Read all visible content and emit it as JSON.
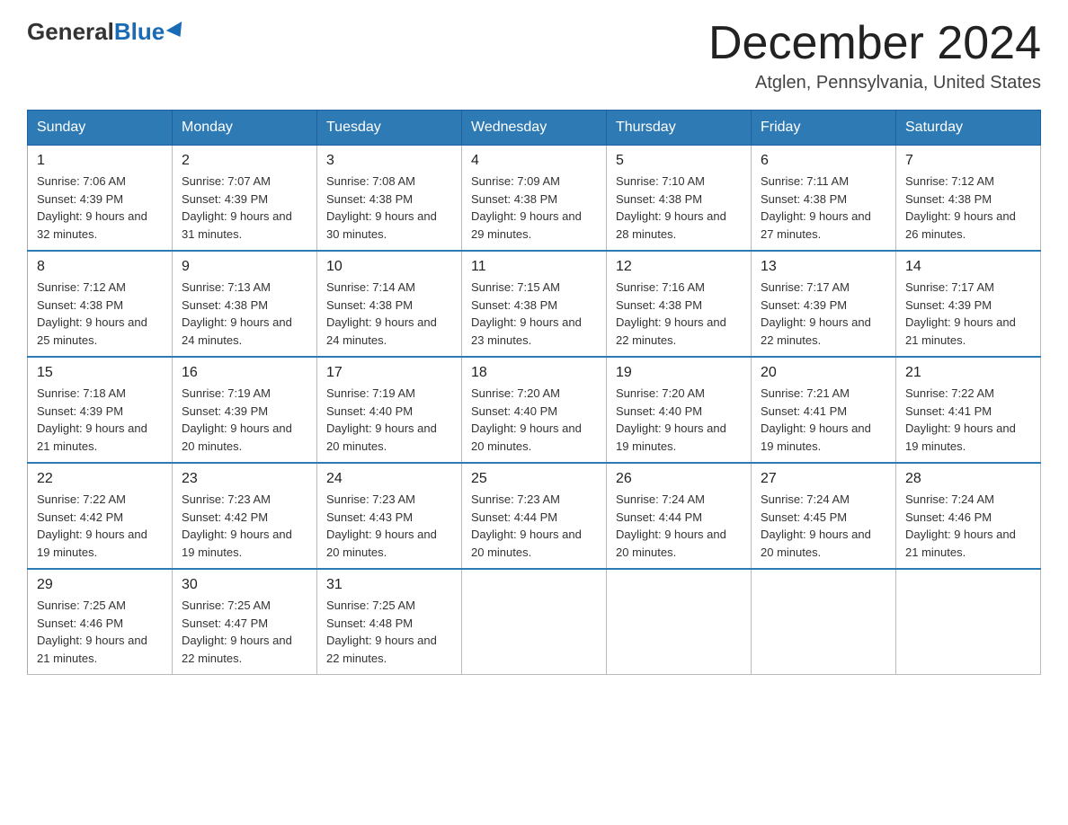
{
  "header": {
    "logo_general": "General",
    "logo_blue": "Blue",
    "month_title": "December 2024",
    "location": "Atglen, Pennsylvania, United States"
  },
  "days_of_week": [
    "Sunday",
    "Monday",
    "Tuesday",
    "Wednesday",
    "Thursday",
    "Friday",
    "Saturday"
  ],
  "weeks": [
    [
      {
        "day": "1",
        "sunrise": "7:06 AM",
        "sunset": "4:39 PM",
        "daylight": "9 hours and 32 minutes."
      },
      {
        "day": "2",
        "sunrise": "7:07 AM",
        "sunset": "4:39 PM",
        "daylight": "9 hours and 31 minutes."
      },
      {
        "day": "3",
        "sunrise": "7:08 AM",
        "sunset": "4:38 PM",
        "daylight": "9 hours and 30 minutes."
      },
      {
        "day": "4",
        "sunrise": "7:09 AM",
        "sunset": "4:38 PM",
        "daylight": "9 hours and 29 minutes."
      },
      {
        "day": "5",
        "sunrise": "7:10 AM",
        "sunset": "4:38 PM",
        "daylight": "9 hours and 28 minutes."
      },
      {
        "day": "6",
        "sunrise": "7:11 AM",
        "sunset": "4:38 PM",
        "daylight": "9 hours and 27 minutes."
      },
      {
        "day": "7",
        "sunrise": "7:12 AM",
        "sunset": "4:38 PM",
        "daylight": "9 hours and 26 minutes."
      }
    ],
    [
      {
        "day": "8",
        "sunrise": "7:12 AM",
        "sunset": "4:38 PM",
        "daylight": "9 hours and 25 minutes."
      },
      {
        "day": "9",
        "sunrise": "7:13 AM",
        "sunset": "4:38 PM",
        "daylight": "9 hours and 24 minutes."
      },
      {
        "day": "10",
        "sunrise": "7:14 AM",
        "sunset": "4:38 PM",
        "daylight": "9 hours and 24 minutes."
      },
      {
        "day": "11",
        "sunrise": "7:15 AM",
        "sunset": "4:38 PM",
        "daylight": "9 hours and 23 minutes."
      },
      {
        "day": "12",
        "sunrise": "7:16 AM",
        "sunset": "4:38 PM",
        "daylight": "9 hours and 22 minutes."
      },
      {
        "day": "13",
        "sunrise": "7:17 AM",
        "sunset": "4:39 PM",
        "daylight": "9 hours and 22 minutes."
      },
      {
        "day": "14",
        "sunrise": "7:17 AM",
        "sunset": "4:39 PM",
        "daylight": "9 hours and 21 minutes."
      }
    ],
    [
      {
        "day": "15",
        "sunrise": "7:18 AM",
        "sunset": "4:39 PM",
        "daylight": "9 hours and 21 minutes."
      },
      {
        "day": "16",
        "sunrise": "7:19 AM",
        "sunset": "4:39 PM",
        "daylight": "9 hours and 20 minutes."
      },
      {
        "day": "17",
        "sunrise": "7:19 AM",
        "sunset": "4:40 PM",
        "daylight": "9 hours and 20 minutes."
      },
      {
        "day": "18",
        "sunrise": "7:20 AM",
        "sunset": "4:40 PM",
        "daylight": "9 hours and 20 minutes."
      },
      {
        "day": "19",
        "sunrise": "7:20 AM",
        "sunset": "4:40 PM",
        "daylight": "9 hours and 19 minutes."
      },
      {
        "day": "20",
        "sunrise": "7:21 AM",
        "sunset": "4:41 PM",
        "daylight": "9 hours and 19 minutes."
      },
      {
        "day": "21",
        "sunrise": "7:22 AM",
        "sunset": "4:41 PM",
        "daylight": "9 hours and 19 minutes."
      }
    ],
    [
      {
        "day": "22",
        "sunrise": "7:22 AM",
        "sunset": "4:42 PM",
        "daylight": "9 hours and 19 minutes."
      },
      {
        "day": "23",
        "sunrise": "7:23 AM",
        "sunset": "4:42 PM",
        "daylight": "9 hours and 19 minutes."
      },
      {
        "day": "24",
        "sunrise": "7:23 AM",
        "sunset": "4:43 PM",
        "daylight": "9 hours and 20 minutes."
      },
      {
        "day": "25",
        "sunrise": "7:23 AM",
        "sunset": "4:44 PM",
        "daylight": "9 hours and 20 minutes."
      },
      {
        "day": "26",
        "sunrise": "7:24 AM",
        "sunset": "4:44 PM",
        "daylight": "9 hours and 20 minutes."
      },
      {
        "day": "27",
        "sunrise": "7:24 AM",
        "sunset": "4:45 PM",
        "daylight": "9 hours and 20 minutes."
      },
      {
        "day": "28",
        "sunrise": "7:24 AM",
        "sunset": "4:46 PM",
        "daylight": "9 hours and 21 minutes."
      }
    ],
    [
      {
        "day": "29",
        "sunrise": "7:25 AM",
        "sunset": "4:46 PM",
        "daylight": "9 hours and 21 minutes."
      },
      {
        "day": "30",
        "sunrise": "7:25 AM",
        "sunset": "4:47 PM",
        "daylight": "9 hours and 22 minutes."
      },
      {
        "day": "31",
        "sunrise": "7:25 AM",
        "sunset": "4:48 PM",
        "daylight": "9 hours and 22 minutes."
      },
      null,
      null,
      null,
      null
    ]
  ]
}
